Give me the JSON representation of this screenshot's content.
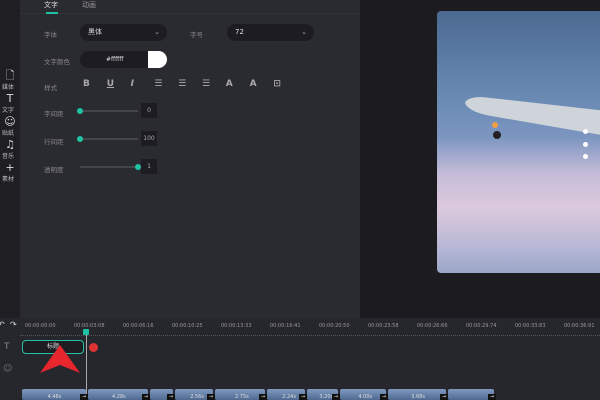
{
  "sidebar": {
    "items": [
      {
        "label": "媒体",
        "icon": "file-icon",
        "glyph": "🗋"
      },
      {
        "label": "文字",
        "icon": "text-icon",
        "glyph": "T"
      },
      {
        "label": "贴纸",
        "icon": "sticker-icon",
        "glyph": "☺"
      },
      {
        "label": "音乐",
        "icon": "music-icon",
        "glyph": "♫"
      },
      {
        "label": "素材",
        "icon": "plus-icon",
        "glyph": "+"
      }
    ]
  },
  "tabs": [
    {
      "label": "文字",
      "active": true
    },
    {
      "label": "动画",
      "active": false
    }
  ],
  "text_panel": {
    "font_label": "字体",
    "font_value": "黑体",
    "size_label": "字号",
    "size_value": "72",
    "color_label": "文字颜色",
    "color_value": "#ffffff",
    "style_label": "样式",
    "style_icons": [
      {
        "name": "bold-icon",
        "glyph": "B"
      },
      {
        "name": "underline-icon",
        "glyph": "U"
      },
      {
        "name": "italic-icon",
        "glyph": "I"
      },
      {
        "name": "align-left-icon",
        "glyph": "☰"
      },
      {
        "name": "align-center-icon",
        "glyph": "☰"
      },
      {
        "name": "align-right-icon",
        "glyph": "☰"
      },
      {
        "name": "outline-text-icon",
        "glyph": "A"
      },
      {
        "name": "shadow-text-icon",
        "glyph": "A"
      },
      {
        "name": "text-box-icon",
        "glyph": "⊡"
      }
    ],
    "letter_spacing_label": "字间距",
    "letter_spacing_value": "0",
    "letter_spacing_fraction": 0,
    "line_spacing_label": "行间距",
    "line_spacing_value": "100",
    "line_spacing_fraction": 0,
    "opacity_label": "透明度",
    "opacity_value": "1",
    "opacity_fraction": 1
  },
  "colors": {
    "accent": "#1fc3a3",
    "panel": "#2a2a31",
    "swatch": "#ffffff"
  },
  "timeline": {
    "timecodes": [
      "00:00:00:00",
      "00:00:03:08",
      "00:00:06:16",
      "00:00:10:25",
      "00:00:13:33",
      "00:00:16:41",
      "00:00:20:50",
      "00:00:23:58",
      "00:00:26:66",
      "00:00:29:74",
      "00:00:33:83",
      "00:00:36:91"
    ],
    "text_clip_label": "标题",
    "video_clips": [
      "4.48s",
      "4.28s",
      "",
      "2.56s",
      "2.75s",
      "2.24s",
      "3.20s",
      "4.00s",
      "3.68s",
      ""
    ]
  }
}
